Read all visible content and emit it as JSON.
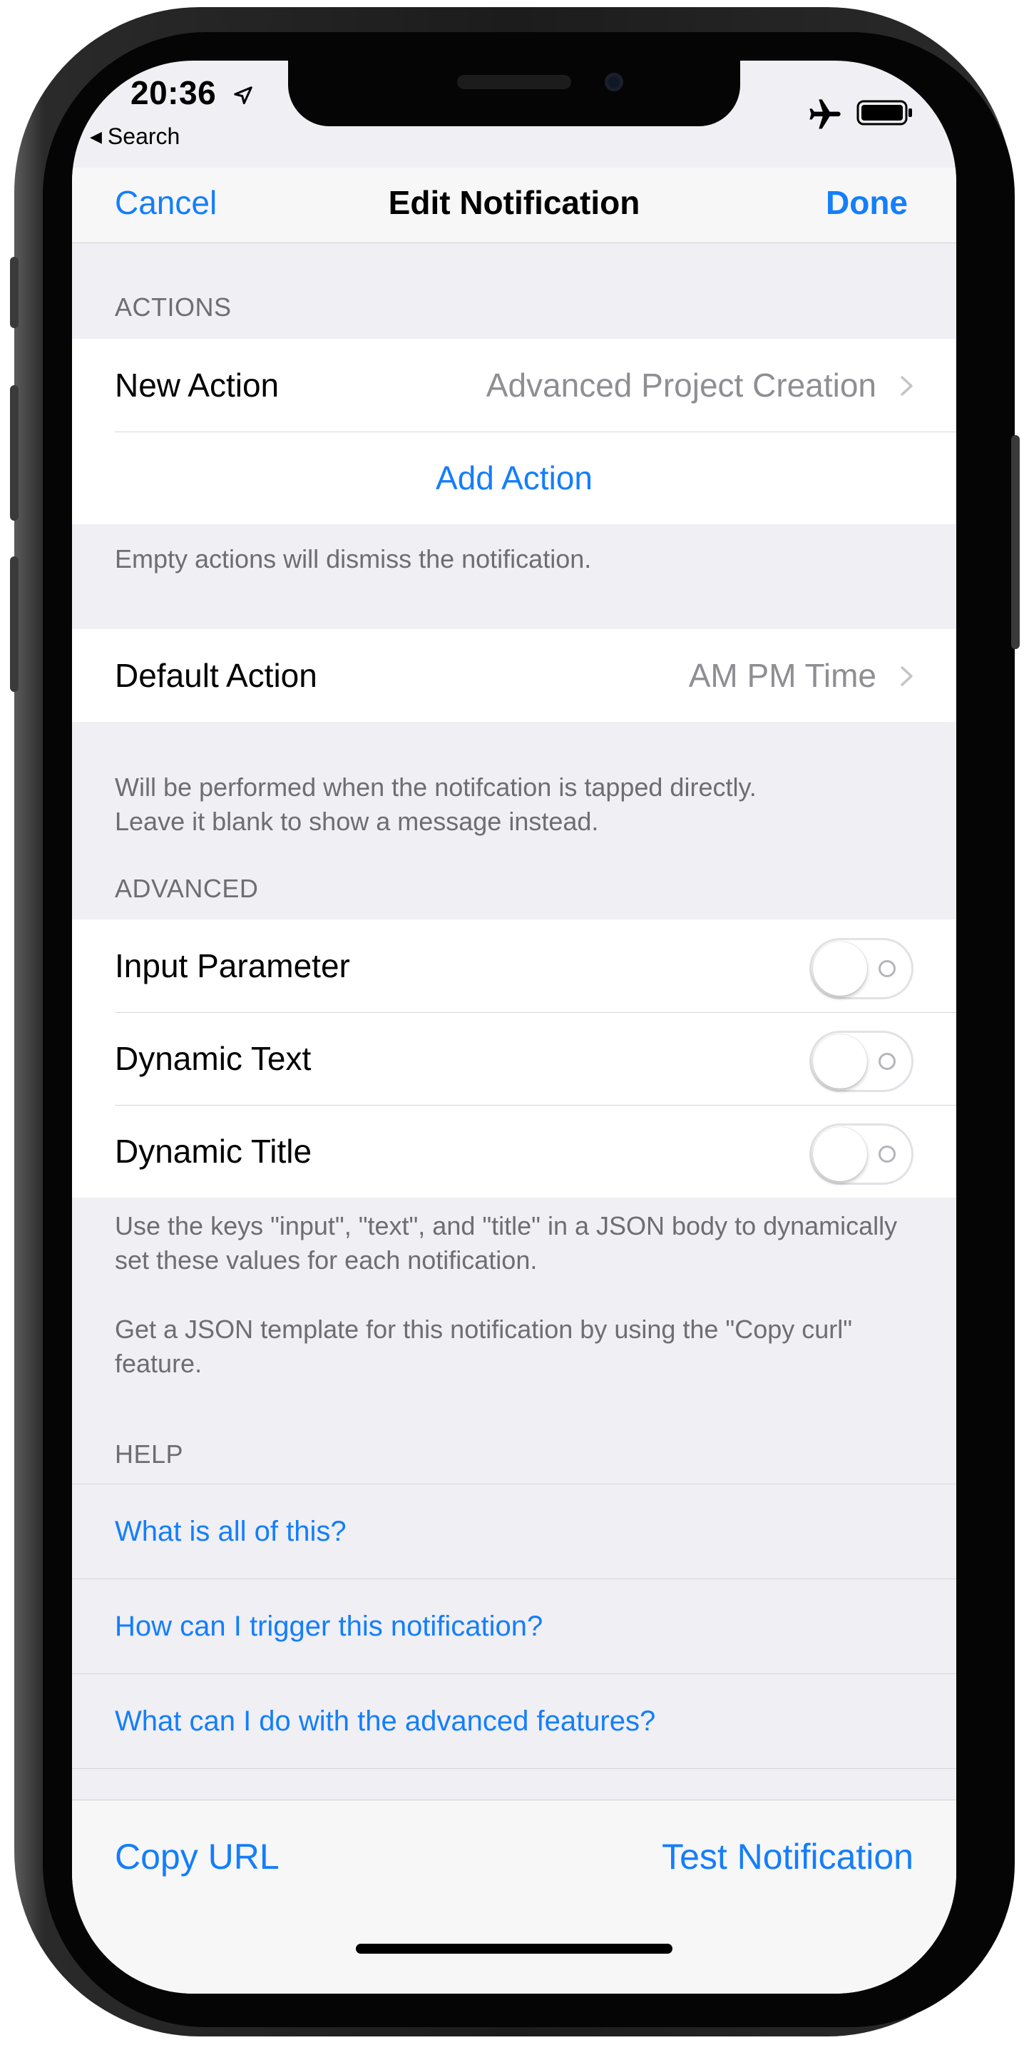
{
  "status_bar": {
    "time": "20:36",
    "back_app": "Search",
    "icons": [
      "location-arrow-icon",
      "airplane-icon",
      "battery-icon"
    ]
  },
  "navbar": {
    "cancel": "Cancel",
    "title": "Edit Notification",
    "done": "Done"
  },
  "actions_section": {
    "header": "ACTIONS",
    "new_action_label": "New Action",
    "new_action_value": "Advanced Project Creation",
    "add_action": "Add Action",
    "footer": "Empty actions will dismiss the notification."
  },
  "default_action_section": {
    "label": "Default Action",
    "value": "AM PM Time",
    "footer_line1": "Will be performed when the notifcation is tapped directly.",
    "footer_line2": "Leave it blank to show a message instead."
  },
  "advanced_section": {
    "header": "ADVANCED",
    "toggles": [
      {
        "label": "Input Parameter",
        "on": false
      },
      {
        "label": "Dynamic Text",
        "on": false
      },
      {
        "label": "Dynamic Title",
        "on": false
      }
    ],
    "footer_para1": "Use the keys \"input\", \"text\", and \"title\" in a JSON body to dynamically set these values for each notification.",
    "footer_para2": "Get a JSON template for this notification by using the \"Copy curl\" feature."
  },
  "help_section": {
    "header": "HELP",
    "links": [
      "What is all of this?",
      "How can I trigger this notification?",
      "What can I do with the advanced features?"
    ]
  },
  "toolbar": {
    "copy_url": "Copy URL",
    "test_notification": "Test Notification"
  },
  "colors": {
    "accent": "#147efb",
    "grouped_background": "#efeff4",
    "secondary_text": "#6d6d72"
  }
}
